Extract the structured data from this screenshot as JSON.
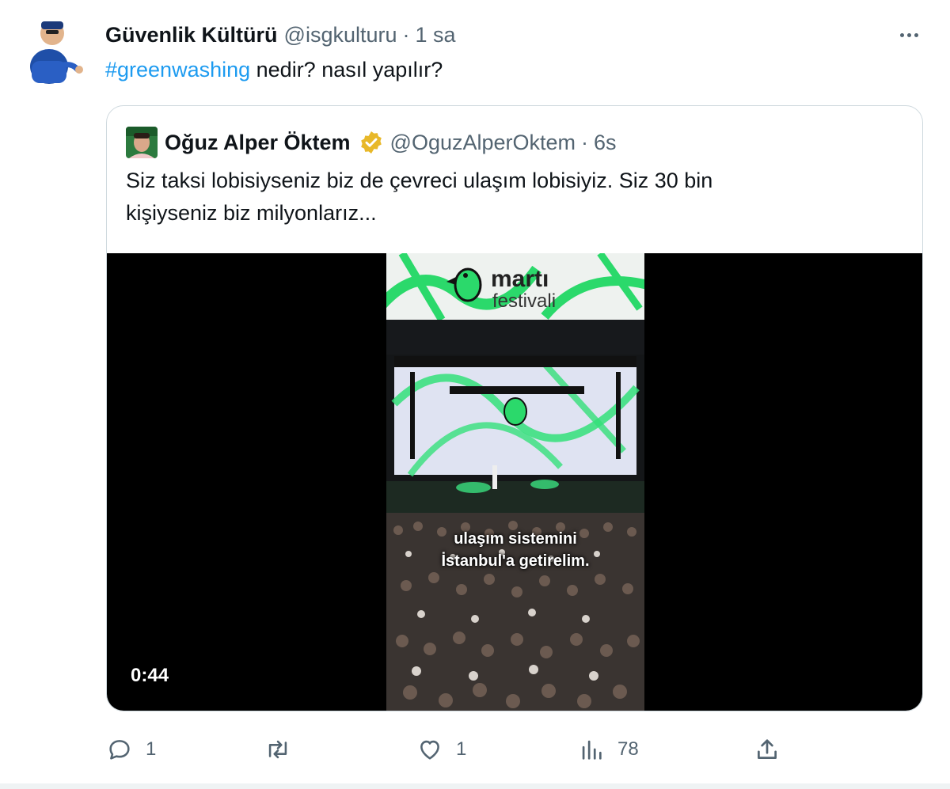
{
  "tweet": {
    "author_name": "Güvenlik Kültürü",
    "handle": "@isgkulturu",
    "separator": "·",
    "time": "1 sa",
    "hashtag": "#greenwashing",
    "text": " nedir? nasıl yapılır?"
  },
  "quote": {
    "author_name": "Oğuz Alper Öktem",
    "handle": "@OguzAlperOktem",
    "separator": "·",
    "time": "6s",
    "text_line1": "Siz taksi lobisiyseniz biz de çevreci ulaşım lobisiyiz. Siz 30 bin",
    "text_line2": "kişiyseniz biz milyonlarız...",
    "video": {
      "duration": "0:44",
      "logo_line1": "martı",
      "logo_line2": "festivali",
      "subtitle_line1": "ulaşım sistemini",
      "subtitle_line2": "İstanbul'a getirelim."
    }
  },
  "actions": {
    "replies": "1",
    "retweets": "",
    "likes": "1",
    "views": "78"
  },
  "colors": {
    "accent": "#1d9bf0",
    "muted": "#536471",
    "brand_green": "#2bd96b",
    "verified_gold": "#e8b829"
  }
}
